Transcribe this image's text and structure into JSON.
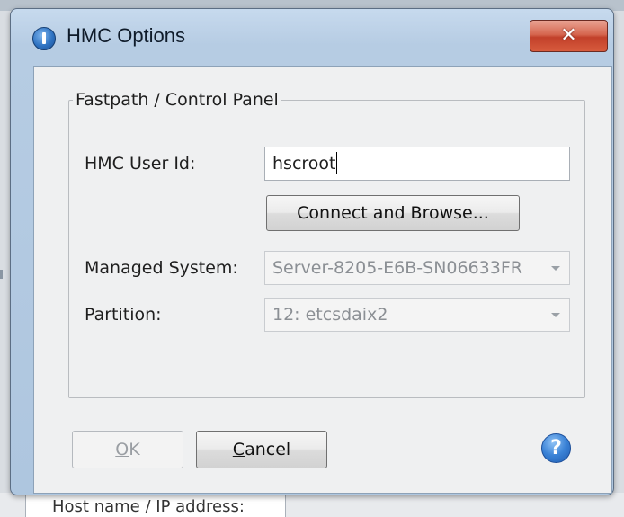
{
  "background": {
    "bottom_text": "Host name / IP address:"
  },
  "window": {
    "title": "HMC Options",
    "app_icon": "info-icon",
    "close_icon": "close-icon",
    "close_glyph": "✕"
  },
  "group": {
    "legend": "Fastpath / Control Panel",
    "hmc_user_id": {
      "label": "HMC User Id:",
      "value": "hscroot"
    },
    "connect_button": {
      "label": "Connect and Browse..."
    },
    "managed_system": {
      "label": "Managed System:",
      "value": "Server-8205-E6B-SN06633FR",
      "enabled": false
    },
    "partition": {
      "label": "Partition:",
      "value": "12: etcsdaix2",
      "enabled": false
    }
  },
  "buttons": {
    "ok": {
      "mnemonic": "O",
      "rest": "K",
      "enabled": false
    },
    "cancel": {
      "mnemonic": "C",
      "rest": "ancel",
      "enabled": true
    }
  },
  "help": {
    "icon": "help-icon",
    "glyph": "?"
  },
  "colors": {
    "frame": "#b6cce3",
    "close_button": "#c2402a",
    "client_bg": "#eff0f1",
    "help_blue": "#3a82d6"
  }
}
